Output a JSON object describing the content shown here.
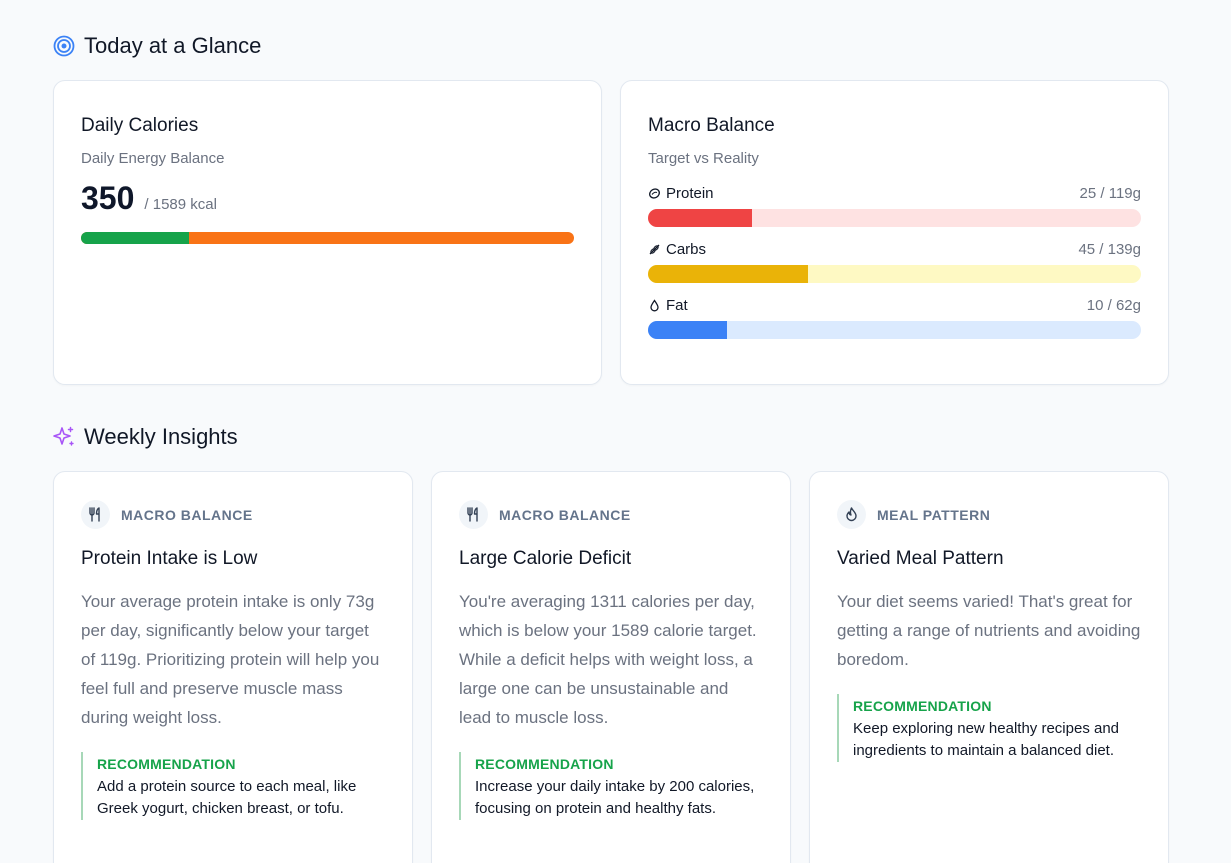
{
  "today": {
    "title": "Today at a Glance"
  },
  "calories": {
    "title": "Daily Calories",
    "subtitle": "Daily Energy Balance",
    "value": "350",
    "target": "/ 1589 kcal",
    "progress_fraction": 0.22,
    "colors": {
      "consumed": "#16a34a",
      "remaining": "#f97316"
    }
  },
  "macros": {
    "title": "Macro Balance",
    "subtitle": "Target vs Reality",
    "items": [
      {
        "name": "Protein",
        "value": "25 / 119g",
        "fraction": 0.21,
        "fill": "#ef4444",
        "track": "#fee2e2",
        "icon": "protein-icon"
      },
      {
        "name": "Carbs",
        "value": "45 / 139g",
        "fraction": 0.325,
        "fill": "#eab308",
        "track": "#fef9c3",
        "icon": "carbs-icon"
      },
      {
        "name": "Fat",
        "value": "10 / 62g",
        "fraction": 0.16,
        "fill": "#3b82f6",
        "track": "#dbeafe",
        "icon": "drop-icon"
      }
    ]
  },
  "weekly": {
    "title": "Weekly Insights",
    "insights": [
      {
        "category": "MACRO BALANCE",
        "icon": "utensils-icon",
        "title": "Protein Intake is Low",
        "body": "Your average protein intake is only 73g per day, significantly below your target of 119g. Prioritizing protein will help you feel full and preserve muscle mass during weight loss.",
        "rec_label": "RECOMMENDATION",
        "rec_text": "Add a protein source to each meal, like Greek yogurt, chicken breast, or tofu."
      },
      {
        "category": "MACRO BALANCE",
        "icon": "utensils-icon",
        "title": "Large Calorie Deficit",
        "body": "You're averaging 1311 calories per day, which is below your 1589 calorie target. While a deficit helps with weight loss, a large one can be unsustainable and lead to muscle loss.",
        "rec_label": "RECOMMENDATION",
        "rec_text": "Increase your daily intake by 200 calories, focusing on protein and healthy fats."
      },
      {
        "category": "MEAL PATTERN",
        "icon": "flame-icon",
        "title": "Varied Meal Pattern",
        "body": "Your diet seems varied! That's great for getting a range of nutrients and avoiding boredom.",
        "rec_label": "RECOMMENDATION",
        "rec_text": "Keep exploring new healthy recipes and ingredients to maintain a balanced diet."
      }
    ]
  }
}
